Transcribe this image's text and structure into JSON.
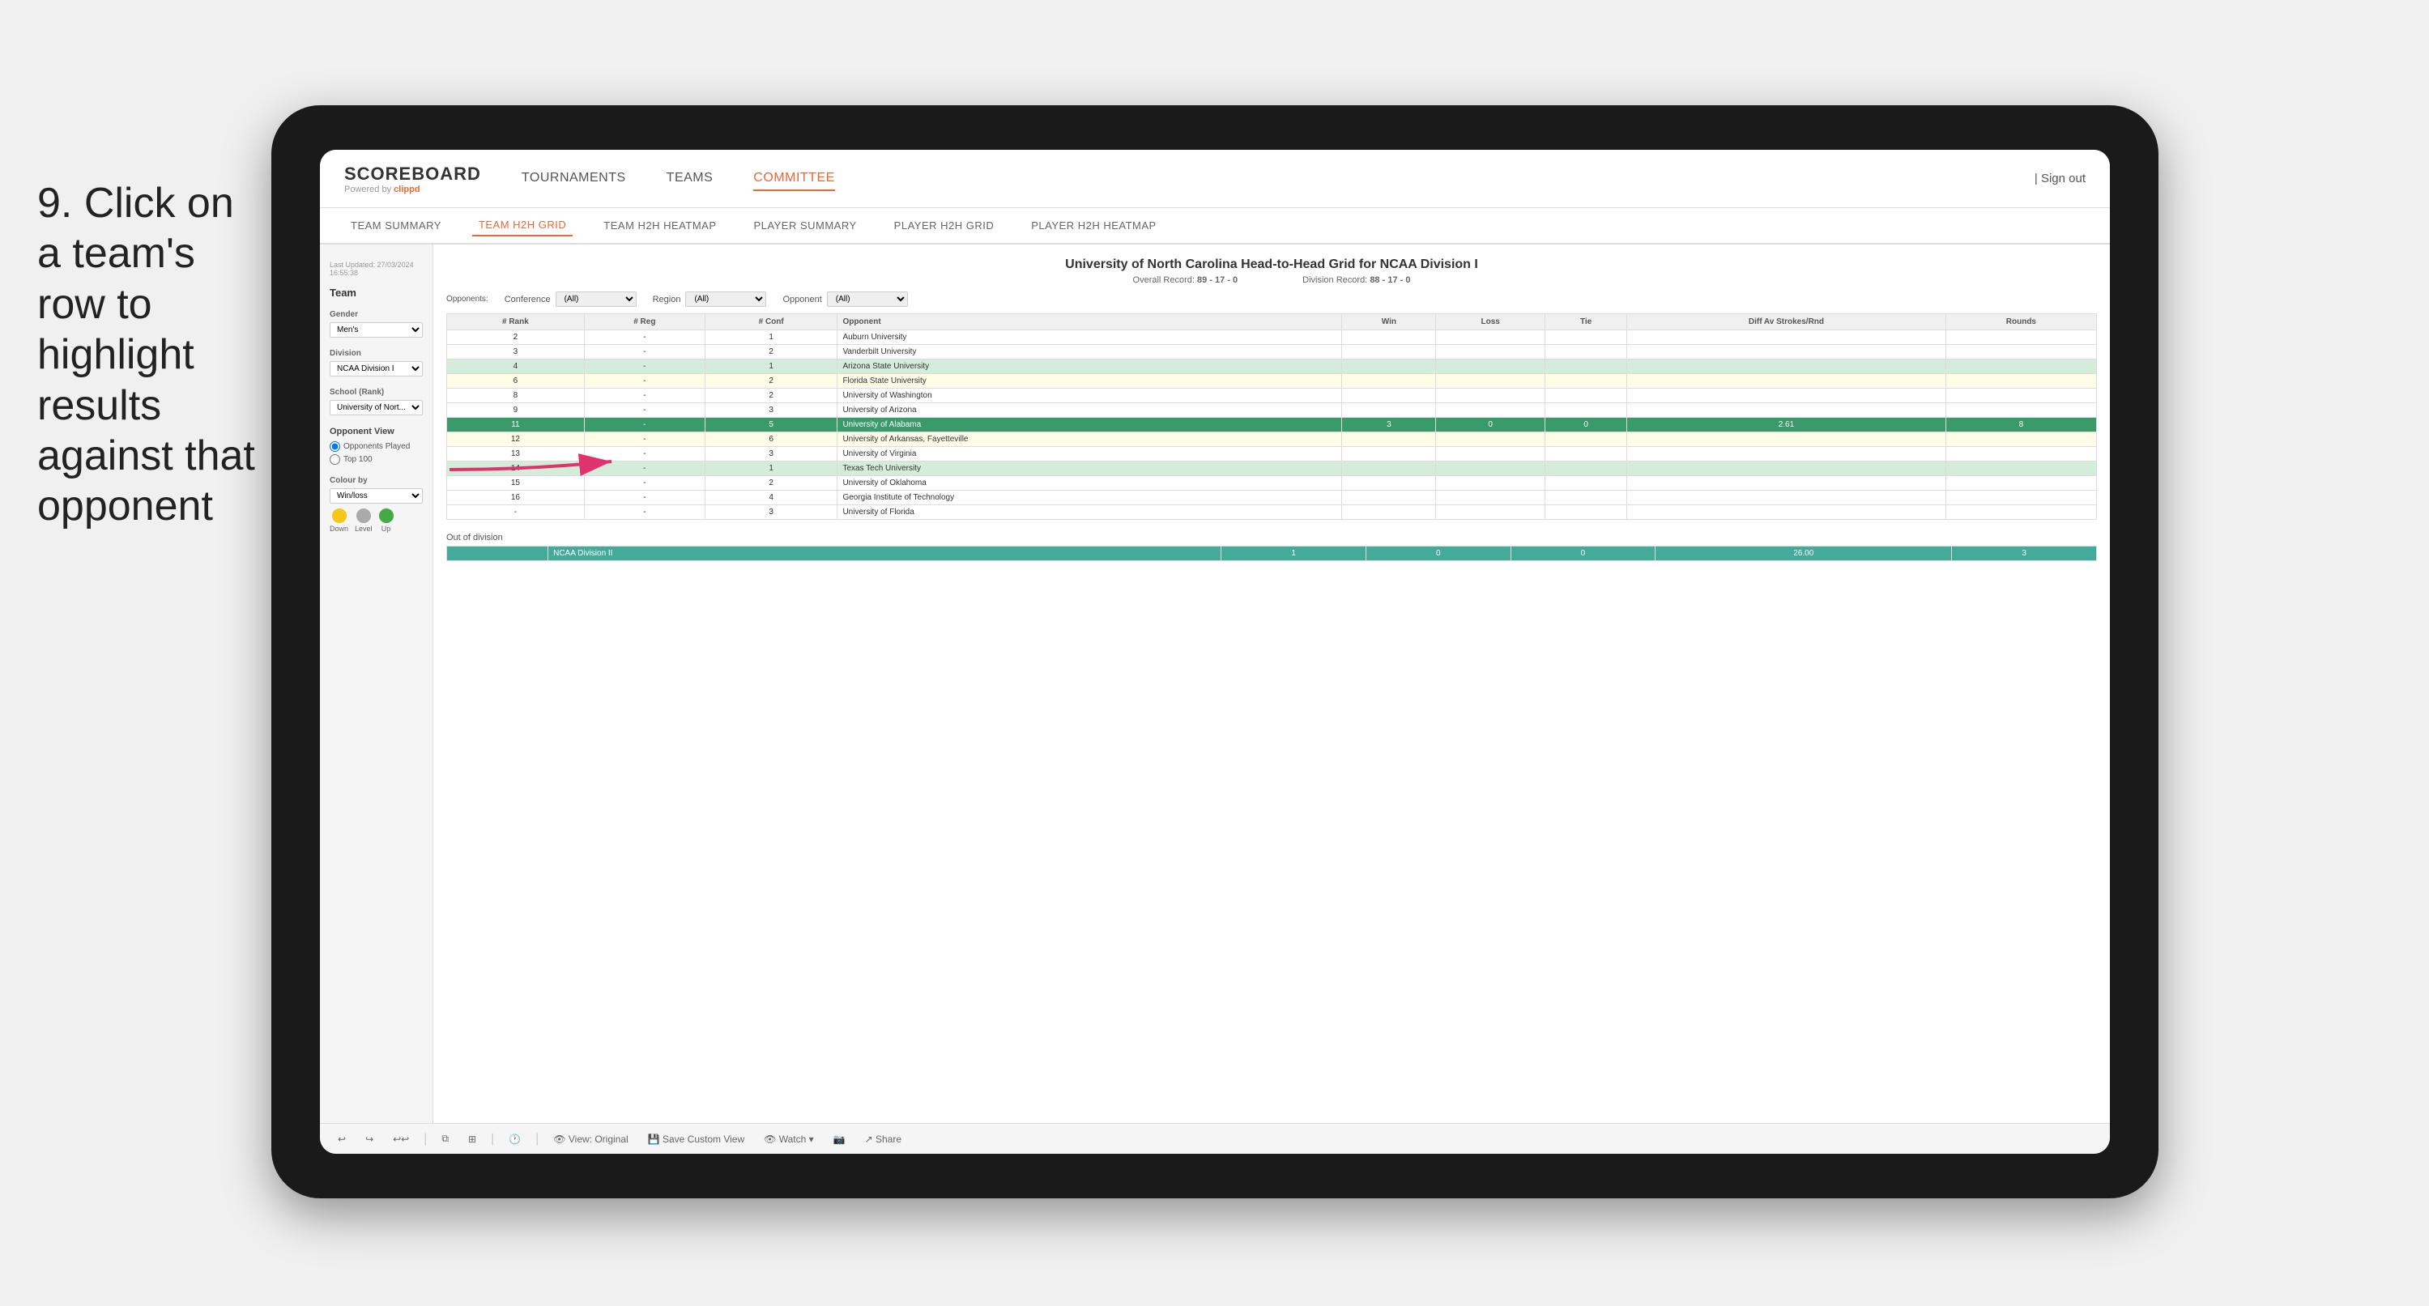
{
  "instruction": {
    "step": "9.",
    "text": "Click on a team's row to highlight results against that opponent"
  },
  "nav": {
    "logo": "SCOREBOARD",
    "powered_by": "Powered by",
    "clippd": "clippd",
    "items": [
      "TOURNAMENTS",
      "TEAMS",
      "COMMITTEE"
    ],
    "active_item": "COMMITTEE",
    "sign_out_label": "Sign out"
  },
  "sub_nav": {
    "items": [
      "TEAM SUMMARY",
      "TEAM H2H GRID",
      "TEAM H2H HEATMAP",
      "PLAYER SUMMARY",
      "PLAYER H2H GRID",
      "PLAYER H2H HEATMAP"
    ],
    "active": "TEAM H2H GRID"
  },
  "sidebar": {
    "last_updated_label": "Last Updated: 27/03/2024",
    "last_updated_time": "16:55:38",
    "team_label": "Team",
    "gender_label": "Gender",
    "gender_value": "Men's",
    "division_label": "Division",
    "division_value": "NCAA Division I",
    "school_label": "School (Rank)",
    "school_value": "University of Nort...",
    "opponent_view_label": "Opponent View",
    "opponents_played": "Opponents Played",
    "top_100": "Top 100",
    "colour_by_label": "Colour by",
    "colour_by_value": "Win/loss",
    "down_label": "Down",
    "level_label": "Level",
    "up_label": "Up"
  },
  "chart": {
    "title": "University of North Carolina Head-to-Head Grid for NCAA Division I",
    "overall_record_label": "Overall Record:",
    "overall_record": "89 - 17 - 0",
    "division_record_label": "Division Record:",
    "division_record": "88 - 17 - 0",
    "conference_label": "Conference",
    "conference_value": "(All)",
    "region_label": "Region",
    "region_value": "(All)",
    "opponent_label": "Opponent",
    "opponent_value": "(All)",
    "opponents_label": "Opponents:",
    "columns": {
      "rank": "# Rank",
      "reg": "# Reg",
      "conf": "# Conf",
      "opponent": "Opponent",
      "win": "Win",
      "loss": "Loss",
      "tie": "Tie",
      "diff_av": "Diff Av Strokes/Rnd",
      "rounds": "Rounds"
    },
    "rows": [
      {
        "rank": "2",
        "reg": "-",
        "conf": "1",
        "opponent": "Auburn University",
        "win": "",
        "loss": "",
        "tie": "",
        "diff": "",
        "rounds": "",
        "style": "normal"
      },
      {
        "rank": "3",
        "reg": "-",
        "conf": "2",
        "opponent": "Vanderbilt University",
        "win": "",
        "loss": "",
        "tie": "",
        "diff": "",
        "rounds": "",
        "style": "normal"
      },
      {
        "rank": "4",
        "reg": "-",
        "conf": "1",
        "opponent": "Arizona State University",
        "win": "",
        "loss": "",
        "tie": "",
        "diff": "",
        "rounds": "",
        "style": "light-green"
      },
      {
        "rank": "6",
        "reg": "-",
        "conf": "2",
        "opponent": "Florida State University",
        "win": "",
        "loss": "",
        "tie": "",
        "diff": "",
        "rounds": "",
        "style": "light-yellow"
      },
      {
        "rank": "8",
        "reg": "-",
        "conf": "2",
        "opponent": "University of Washington",
        "win": "",
        "loss": "",
        "tie": "",
        "diff": "",
        "rounds": "",
        "style": "normal"
      },
      {
        "rank": "9",
        "reg": "-",
        "conf": "3",
        "opponent": "University of Arizona",
        "win": "",
        "loss": "",
        "tie": "",
        "diff": "",
        "rounds": "",
        "style": "normal"
      },
      {
        "rank": "11",
        "reg": "-",
        "conf": "5",
        "opponent": "University of Alabama",
        "win": "3",
        "loss": "0",
        "tie": "0",
        "diff": "2.61",
        "rounds": "8",
        "style": "highlighted"
      },
      {
        "rank": "12",
        "reg": "-",
        "conf": "6",
        "opponent": "University of Arkansas, Fayetteville",
        "win": "",
        "loss": "",
        "tie": "",
        "diff": "",
        "rounds": "",
        "style": "light-yellow"
      },
      {
        "rank": "13",
        "reg": "-",
        "conf": "3",
        "opponent": "University of Virginia",
        "win": "",
        "loss": "",
        "tie": "",
        "diff": "",
        "rounds": "",
        "style": "normal"
      },
      {
        "rank": "14",
        "reg": "-",
        "conf": "1",
        "opponent": "Texas Tech University",
        "win": "",
        "loss": "",
        "tie": "",
        "diff": "",
        "rounds": "",
        "style": "light-green"
      },
      {
        "rank": "15",
        "reg": "-",
        "conf": "2",
        "opponent": "University of Oklahoma",
        "win": "",
        "loss": "",
        "tie": "",
        "diff": "",
        "rounds": "",
        "style": "normal"
      },
      {
        "rank": "16",
        "reg": "-",
        "conf": "4",
        "opponent": "Georgia Institute of Technology",
        "win": "",
        "loss": "",
        "tie": "",
        "diff": "",
        "rounds": "",
        "style": "normal"
      },
      {
        "rank": "-",
        "reg": "-",
        "conf": "3",
        "opponent": "University of Florida",
        "win": "",
        "loss": "",
        "tie": "",
        "diff": "",
        "rounds": "",
        "style": "normal"
      }
    ],
    "out_of_division_label": "Out of division",
    "out_division_row": {
      "label": "NCAA Division II",
      "win": "1",
      "loss": "0",
      "tie": "0",
      "diff": "26.00",
      "rounds": "3"
    }
  },
  "toolbar": {
    "view_label": "View: Original",
    "save_label": "Save Custom View",
    "watch_label": "Watch",
    "share_label": "Share"
  }
}
